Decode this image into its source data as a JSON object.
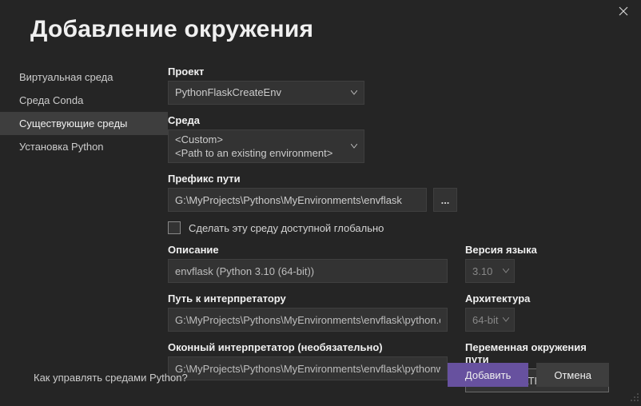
{
  "title": "Добавление окружения",
  "sidebar": {
    "items": [
      {
        "label": "Виртуальная среда"
      },
      {
        "label": "Среда Conda"
      },
      {
        "label": "Существующие среды"
      },
      {
        "label": "Установка Python"
      }
    ],
    "activeIndex": 2
  },
  "fields": {
    "project": {
      "label": "Проект",
      "value": "PythonFlaskCreateEnv"
    },
    "environment": {
      "label": "Среда",
      "valueLine1": "<Custom>",
      "valueLine2": "<Path to an existing environment>"
    },
    "prefixPath": {
      "label": "Префикс пути",
      "value": "G:\\MyProjects\\Pythons\\MyEnvironments\\envflask",
      "browse": "..."
    },
    "makeGlobal": {
      "label": "Сделать эту среду доступной глобально",
      "checked": false
    },
    "description": {
      "label": "Описание",
      "value": "envflask (Python 3.10 (64-bit))"
    },
    "interpreterPath": {
      "label": "Путь к интерпретатору",
      "value": "G:\\MyProjects\\Pythons\\MyEnvironments\\envflask\\python.exe"
    },
    "windowedInterpreter": {
      "label": "Оконный интерпретатор (необязательно)",
      "value": "G:\\MyProjects\\Pythons\\MyEnvironments\\envflask\\pythonw.exe"
    },
    "languageVersion": {
      "label": "Версия языка",
      "value": "3.10"
    },
    "architecture": {
      "label": "Архитектура",
      "value": "64-bit"
    },
    "pathEnvVar": {
      "label": "Переменная окружения пути",
      "value": "PYTHONPATH"
    }
  },
  "footer": {
    "helpLink": "Как управлять средами Python?",
    "addButton": "Добавить",
    "cancelButton": "Отмена"
  }
}
